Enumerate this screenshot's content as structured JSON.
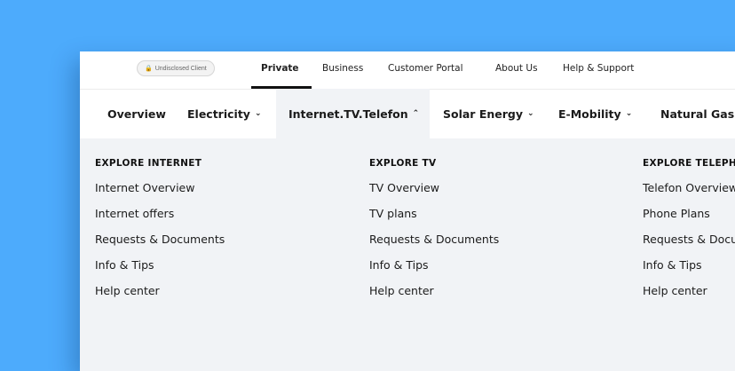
{
  "topbar": {
    "badge": "Undisclosed Client",
    "links": [
      {
        "label": "Private"
      },
      {
        "label": "Business"
      },
      {
        "label": "Customer Portal"
      },
      {
        "label": "About Us"
      },
      {
        "label": "Help & Support"
      }
    ]
  },
  "mainnav": {
    "items": [
      {
        "label": "Overview"
      },
      {
        "label": "Electricity"
      },
      {
        "label": "Internet.TV.Telefon"
      },
      {
        "label": "Solar Energy"
      },
      {
        "label": "E-Mobility"
      },
      {
        "label": "Natural Gas"
      }
    ]
  },
  "dropdown": {
    "columns": [
      {
        "title": "EXPLORE INTERNET",
        "links": [
          "Internet Overview",
          "Internet offers",
          "Requests & Documents",
          "Info & Tips",
          "Help center"
        ]
      },
      {
        "title": "EXPLORE TV",
        "links": [
          "TV Overview",
          "TV plans",
          "Requests & Documents",
          "Info & Tips",
          "Help center"
        ]
      },
      {
        "title": "EXPLORE TELEPHONE",
        "links": [
          "Telefon Overview",
          "Phone Plans",
          "Requests & Documents",
          "Info & Tips",
          "Help center"
        ]
      }
    ]
  },
  "colors": {
    "background": "#4dabfc",
    "panel": "#f1f3f6",
    "text": "#1b1b1b"
  }
}
